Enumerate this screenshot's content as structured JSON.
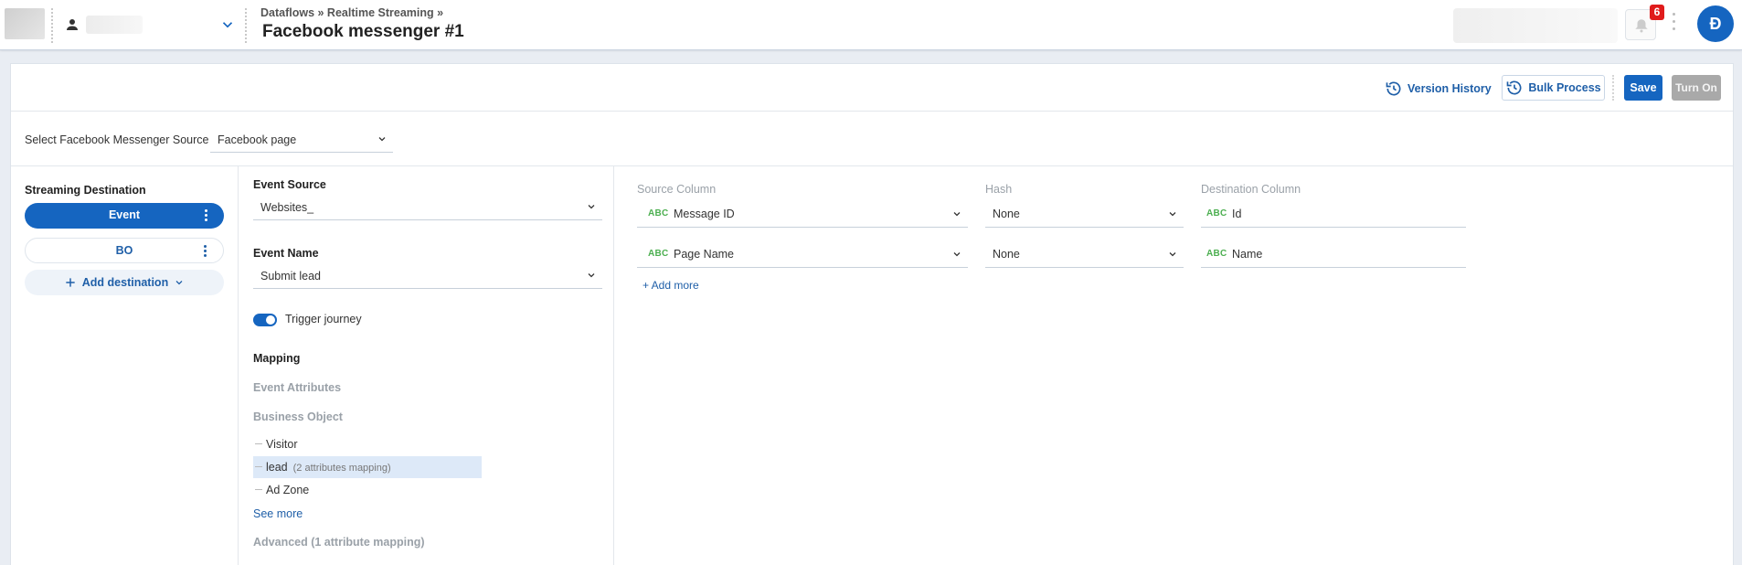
{
  "header": {
    "breadcrumb": "Dataflows » Realtime Streaming »",
    "title": "Facebook messenger #1",
    "notification_count": "6",
    "avatar_initial": "Đ"
  },
  "toolbar": {
    "version_history": "Version History",
    "bulk_process": "Bulk Process",
    "save": "Save",
    "turn_on": "Turn On"
  },
  "source": {
    "label": "Select Facebook Messenger Source",
    "value": "Facebook page"
  },
  "destinations": {
    "title": "Streaming Destination",
    "items": [
      {
        "label": "Event",
        "active": true
      },
      {
        "label": "BO",
        "active": false
      }
    ],
    "add_label": "Add destination"
  },
  "event": {
    "source_title": "Event Source",
    "source_value": "Websites_",
    "name_title": "Event Name",
    "name_value": "Submit lead",
    "trigger_label": "Trigger journey",
    "trigger_on": true
  },
  "mapping": {
    "title": "Mapping",
    "event_attributes": "Event Attributes",
    "business_object": "Business Object",
    "items": [
      {
        "label": "Visitor",
        "sub": ""
      },
      {
        "label": "lead",
        "sub": "(2 attributes mapping)"
      },
      {
        "label": "Ad Zone",
        "sub": ""
      }
    ],
    "see_more": "See more",
    "advanced": "Advanced  (1 attribute mapping)"
  },
  "columns": {
    "source": "Source Column",
    "hash": "Hash",
    "destination": "Destination Column"
  },
  "rows": [
    {
      "type": "ABC",
      "source": "Message ID",
      "hash": "None",
      "dest_type": "ABC",
      "destination": "Id"
    },
    {
      "type": "ABC",
      "source": "Page Name",
      "hash": "None",
      "dest_type": "ABC",
      "destination": "Name"
    }
  ],
  "add_more": "+ Add more",
  "colors": {
    "primary": "#1565c0",
    "link": "#1f5fa8",
    "badge": "#e01b1b",
    "type_tag": "#4caf50"
  }
}
